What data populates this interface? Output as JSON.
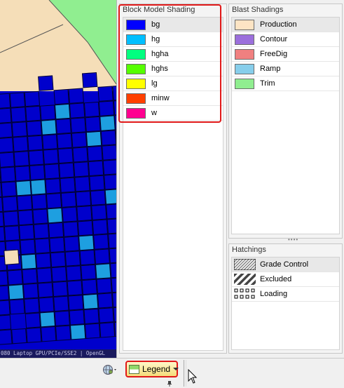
{
  "status_strip_text": "080 Laptop GPU/PCIe/SSE2 | OpenGL",
  "block_model_shading": {
    "title": "Block Model Shading",
    "items": [
      {
        "label": "bg",
        "color": "#0000ff",
        "selected": true
      },
      {
        "label": "hg",
        "color": "#00bfff",
        "selected": false
      },
      {
        "label": "hgha",
        "color": "#00ff80",
        "selected": false
      },
      {
        "label": "hghs",
        "color": "#55ff00",
        "selected": false
      },
      {
        "label": "lg",
        "color": "#ffff00",
        "selected": false
      },
      {
        "label": "minw",
        "color": "#ff4000",
        "selected": false
      },
      {
        "label": "w",
        "color": "#ff0090",
        "selected": false
      }
    ]
  },
  "blast_shadings": {
    "title": "Blast Shadings",
    "items": [
      {
        "label": "Production",
        "color": "#fde4c4",
        "selected": true
      },
      {
        "label": "Contour",
        "color": "#9b6fdc",
        "selected": false
      },
      {
        "label": "FreeDig",
        "color": "#f08080",
        "selected": false
      },
      {
        "label": "Ramp",
        "color": "#87ceeb",
        "selected": false
      },
      {
        "label": "Trim",
        "color": "#90ee90",
        "selected": false
      }
    ]
  },
  "hatchings": {
    "title": "Hatchings",
    "items": [
      {
        "label": "Grade Control",
        "icon": "diagonal-hatch-thin-icon",
        "selected": true
      },
      {
        "label": "Excluded",
        "icon": "diagonal-hatch-thick-icon",
        "selected": false
      },
      {
        "label": "Loading",
        "icon": "dotted-square-hatch-icon",
        "selected": false
      }
    ]
  },
  "bottom_bar": {
    "legend_button_label": "Legend",
    "globe_icon": "globe-icon",
    "pin_icon": "pin-icon"
  },
  "colors": {
    "highlight": "#e01818",
    "block_dark": "#0000cc",
    "block_light": "#1e9fe0",
    "blast_fill": "#f5deb8",
    "trim_fill": "#90ee90"
  }
}
